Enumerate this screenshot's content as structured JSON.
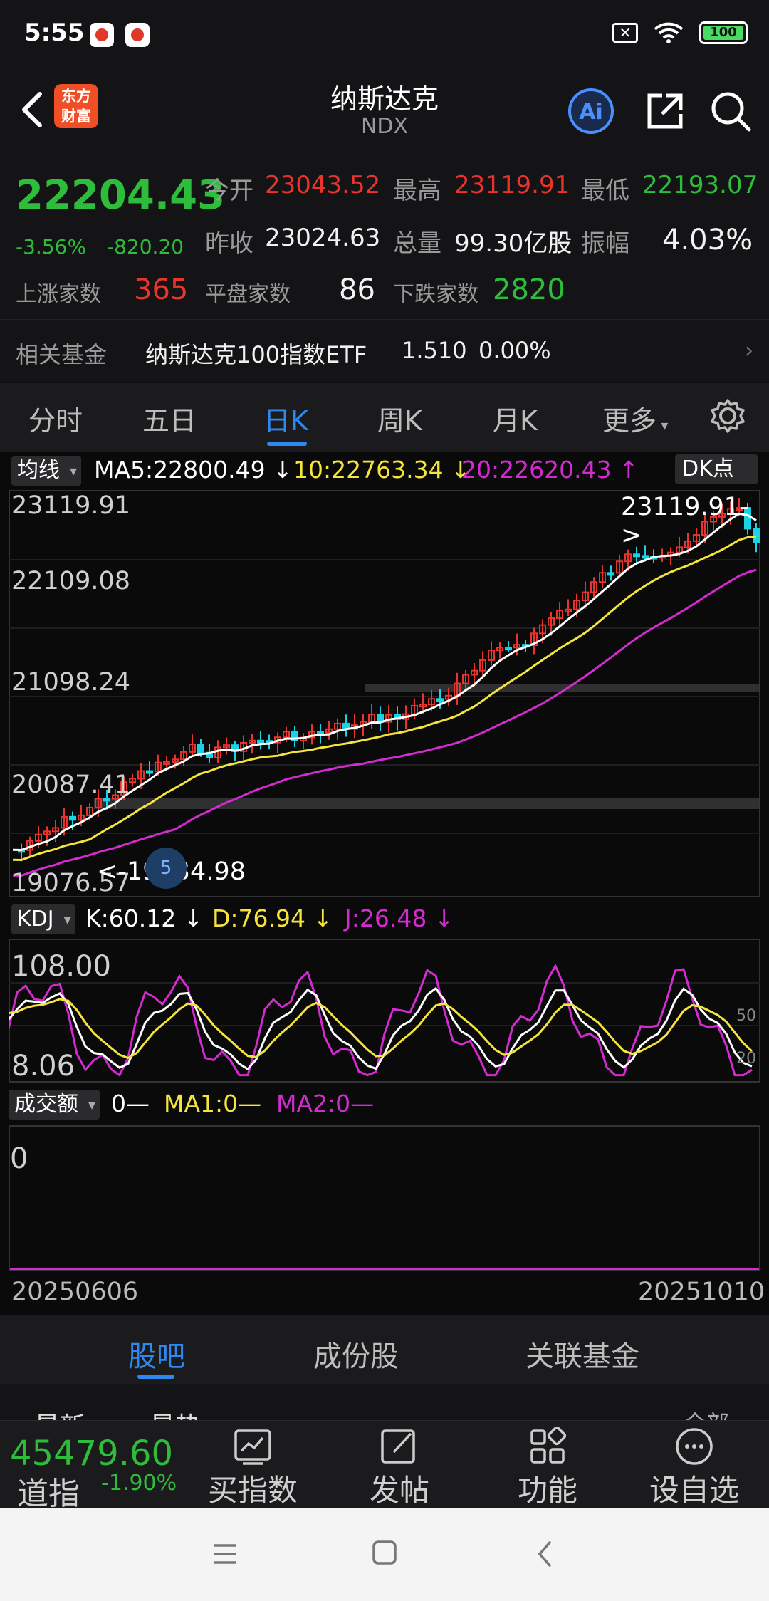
{
  "status_bar": {
    "time": "5:55",
    "battery": "100"
  },
  "header": {
    "title": "纳斯达克",
    "subtitle": "NDX",
    "logo_text": "东方财富",
    "ai_label": "Ai"
  },
  "quote": {
    "price": "22204.43",
    "change_pct": "-3.56%",
    "change_abs": "-820.20",
    "open_label": "今开",
    "open": "23043.52",
    "high_label": "最高",
    "high": "23119.91",
    "low_label": "最低",
    "low": "22193.07",
    "prev_label": "昨收",
    "prev": "23024.63",
    "vol_label": "总量",
    "vol": "99.30亿股",
    "amp_label": "振幅",
    "amp": "4.03%",
    "up_label": "上涨家数",
    "up": "365",
    "flat_label": "平盘家数",
    "flat": "86",
    "down_label": "下跌家数",
    "down": "2820",
    "fund_label": "相关基金",
    "fund_name": "纳斯达克100指数ETF",
    "fund_price": "1.510",
    "fund_change": "0.00%"
  },
  "period_tabs": [
    "分时",
    "五日",
    "日K",
    "周K",
    "月K",
    "更多"
  ],
  "active_period": "日K",
  "ma_legend": {
    "chip": "均线",
    "ma5": "MA5:22800.49 ↓",
    "ma10": "10:22763.34 ↓",
    "ma20": "20:22620.43 ↑",
    "dk": "DK点"
  },
  "price_axis": [
    "23119.91",
    "22109.08",
    "21098.24",
    "20087.41",
    "19076.57"
  ],
  "annotations": {
    "high": "23119.91->",
    "low": "<-19334.98",
    "badge": "5"
  },
  "kdj": {
    "chip": "KDJ",
    "k": "K:60.12 ↓",
    "d": "D:76.94 ↓",
    "j": "J:26.48 ↓",
    "top": "108.00",
    "bottom": "8.06",
    "level50": "50",
    "level20": "20"
  },
  "turnover": {
    "chip": "成交额",
    "v": "0—",
    "ma1": "MA1:0—",
    "ma2": "MA2:0—",
    "axis0": "0"
  },
  "dates": {
    "start": "20250606",
    "end": "20251010"
  },
  "colors": {
    "up": "#e8342c",
    "down": "#2ebd3b",
    "cyan_candle": "#18d2e6",
    "ma5": "#ffffff",
    "ma10": "#f5e43c",
    "ma20": "#d42bd0",
    "accent": "#2e88f0"
  },
  "section_tabs": [
    "股吧",
    "成份股",
    "关联基金"
  ],
  "active_section": "股吧",
  "peek": {
    "left": "最新",
    "mid": "最热",
    "right": "全部"
  },
  "toolbar": {
    "dji_value": "45479.60",
    "dji_name": "道指",
    "dji_change": "-1.90%",
    "buy_index": "买指数",
    "post": "发帖",
    "functions": "功能",
    "watchlist": "设自选"
  }
}
